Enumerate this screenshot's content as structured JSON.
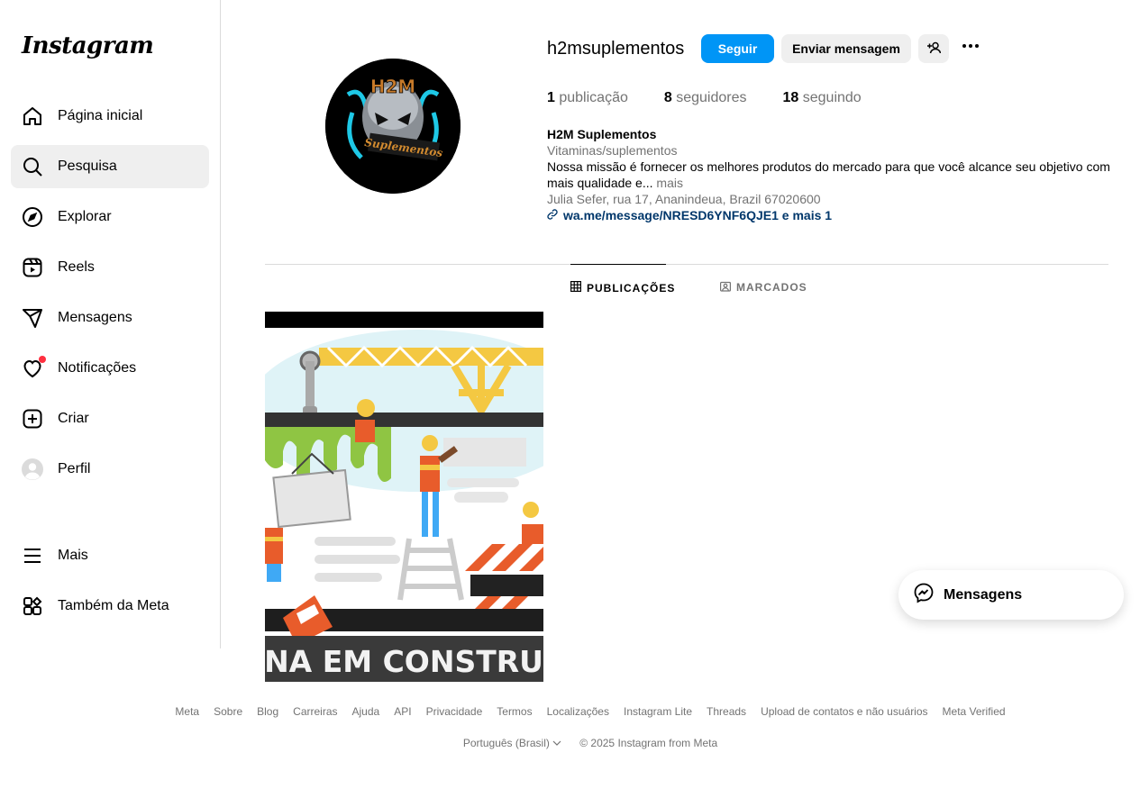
{
  "app": {
    "logo_text": "Instagram"
  },
  "sidebar": {
    "items": [
      {
        "label": "Página inicial",
        "icon": "home-icon"
      },
      {
        "label": "Pesquisa",
        "icon": "search-icon"
      },
      {
        "label": "Explorar",
        "icon": "compass-icon"
      },
      {
        "label": "Reels",
        "icon": "reels-icon"
      },
      {
        "label": "Mensagens",
        "icon": "send-icon"
      },
      {
        "label": "Notificações",
        "icon": "heart-icon"
      },
      {
        "label": "Criar",
        "icon": "plus-square-icon"
      },
      {
        "label": "Perfil",
        "icon": "avatar-icon"
      },
      {
        "label": "Mais",
        "icon": "menu-icon"
      },
      {
        "label": "Também da Meta",
        "icon": "meta-apps-icon"
      }
    ]
  },
  "profile": {
    "username": "h2msuplementos",
    "follow_label": "Seguir",
    "message_label": "Enviar mensagem",
    "avatar_text_top": "H2M",
    "avatar_text_bottom": "Suplementos",
    "stats": {
      "posts_count": "1",
      "posts_label": "publicação",
      "followers_count": "8",
      "followers_label": "seguidores",
      "following_count": "18",
      "following_label": "seguindo"
    },
    "bio": {
      "name": "H2M Suplementos",
      "category": "Vitaminas/suplementos",
      "text": "Nossa missão é fornecer os melhores produtos do mercado para que você alcance seu objetivo com mais qualidade e...",
      "more_label": "mais",
      "address": "Julia Sefer, rua 17, Ananindeua, Brazil 67020600",
      "link": "wa.me/message/NRESD6YNF6QJE1 e mais 1"
    }
  },
  "tabs": [
    {
      "label": "PUBLICAÇÕES",
      "active": true,
      "icon": "grid-icon"
    },
    {
      "label": "MARCADOS",
      "active": false,
      "icon": "tagged-icon"
    }
  ],
  "post": {
    "banner_text": "NA EM CONSTRU"
  },
  "footer": {
    "links": [
      "Meta",
      "Sobre",
      "Blog",
      "Carreiras",
      "Ajuda",
      "API",
      "Privacidade",
      "Termos",
      "Localizações",
      "Instagram Lite",
      "Threads",
      "Upload de contatos e não usuários",
      "Meta Verified"
    ],
    "language": "Português (Brasil)",
    "copyright": "© 2025 Instagram from Meta"
  },
  "messages_pill": {
    "label": "Mensagens"
  },
  "colors": {
    "accent": "#0095f6",
    "notification": "#ff3040",
    "link": "#00376b"
  }
}
